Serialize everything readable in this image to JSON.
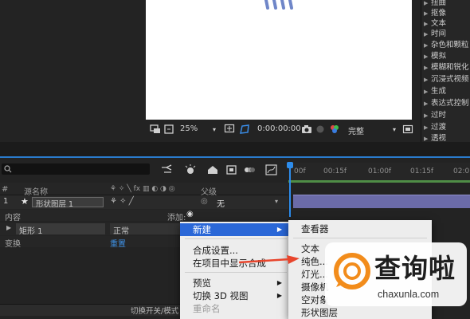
{
  "viewer": {
    "zoom": "25%",
    "timecode": "0:00:00:00",
    "resolution": "完整"
  },
  "effects_list": {
    "items": [
      "扭曲",
      "抠像",
      "文本",
      "时间",
      "杂色和颗粒",
      "模拟",
      "模糊和锐化",
      "沉浸式视频",
      "生成",
      "表达式控制",
      "过时",
      "过渡",
      "透视"
    ]
  },
  "timeline": {
    "ruler": [
      "00f",
      "00:15f",
      "01:00f",
      "01:15f",
      "02:0"
    ],
    "columns": {
      "index": "#",
      "source_name": "源名称",
      "parent": "父级"
    },
    "layer": {
      "index": "1",
      "name": "形状图层 1",
      "parent_value": "无"
    },
    "contents_label": "内容",
    "add_label": "添加:",
    "shape_name": "矩形 1",
    "mode": "正常",
    "transform_label": "变换",
    "reset_label": "重置",
    "toggle_label": "切换开关/模式"
  },
  "context_menu": {
    "items": [
      {
        "label": "新建",
        "submenu": true,
        "active": true
      },
      {
        "label": "合成设置..."
      },
      {
        "label": "在项目中显示合成"
      },
      {
        "label": "预览",
        "submenu": true
      },
      {
        "label": "切换 3D 视图",
        "submenu": true
      },
      {
        "label": "重命名",
        "disabled": true
      }
    ]
  },
  "submenu": {
    "items": [
      "查看器",
      "文本",
      "纯色...",
      "灯光...",
      "摄像机",
      "空对象",
      "形状图层"
    ]
  },
  "watermark": {
    "title": "查询啦",
    "url": "chaxunla.com"
  },
  "colors": {
    "accent_blue": "#2d8ceb",
    "menu_highlight": "#2a67d7",
    "layer_bar": "#6b6ba8",
    "arrow_red": "#e8452c"
  }
}
